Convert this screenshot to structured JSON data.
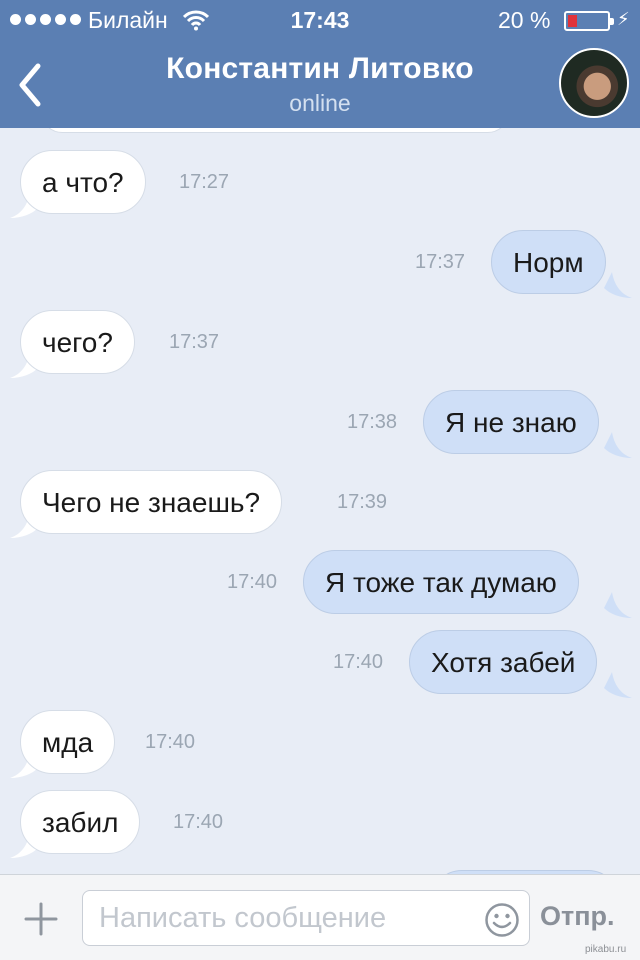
{
  "status_bar": {
    "carrier": "Билайн",
    "time": "17:43",
    "battery": "20 %"
  },
  "header": {
    "title": "Константин Литовко",
    "status": "online"
  },
  "messages": [
    {
      "text": "а что?",
      "time": "17:27",
      "direction": "in"
    },
    {
      "text": "Норм",
      "time": "17:37",
      "direction": "out"
    },
    {
      "text": "чего?",
      "time": "17:37",
      "direction": "in"
    },
    {
      "text": "Я не знаю",
      "time": "17:38",
      "direction": "out"
    },
    {
      "text": "Чего не знаешь?",
      "time": "17:39",
      "direction": "in"
    },
    {
      "text": "Я тоже так думаю",
      "time": "17:40",
      "direction": "out"
    },
    {
      "text": "Хотя забей",
      "time": "17:40",
      "direction": "out"
    },
    {
      "text": "мда",
      "time": "17:40",
      "direction": "in"
    },
    {
      "text": "забил",
      "time": "17:40",
      "direction": "in"
    }
  ],
  "composer": {
    "placeholder": "Написать сообщение",
    "send_label": "Отпр."
  },
  "watermark": "pikabu.ru",
  "colors": {
    "header": "#5b7fb3",
    "background": "#e8edf6",
    "incoming_bubble": "#ffffff",
    "outgoing_bubble": "#cfdff7"
  },
  "icons": {
    "back": "chevron-left-icon",
    "wifi": "wifi-icon",
    "battery": "battery-icon",
    "charging": "bolt-icon",
    "attach": "plus-icon",
    "emoji": "smile-icon"
  }
}
